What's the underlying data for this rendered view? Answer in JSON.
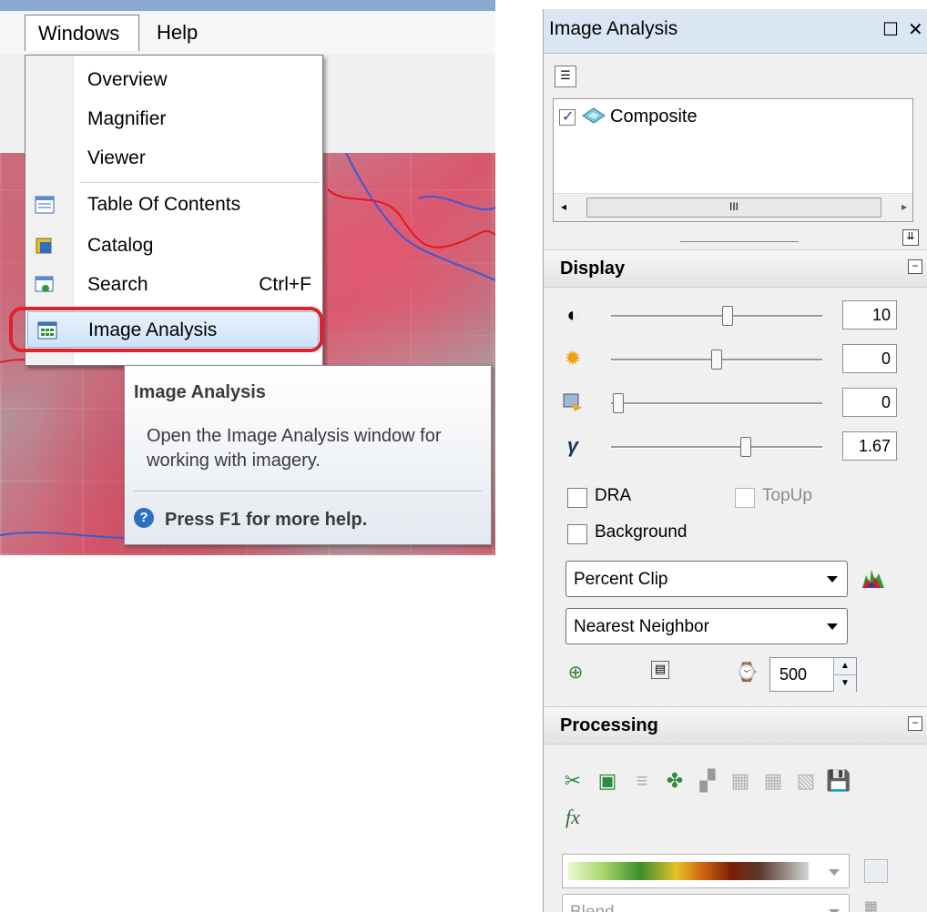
{
  "menubar": {
    "windows": "Windows",
    "help": "Help"
  },
  "windows_menu": {
    "items": [
      {
        "label": "Overview",
        "shortcut": "",
        "icon": ""
      },
      {
        "label": "Magnifier",
        "shortcut": "",
        "icon": ""
      },
      {
        "label": "Viewer",
        "shortcut": "",
        "icon": ""
      },
      {
        "label": "Table Of Contents",
        "shortcut": "",
        "icon": "table-of-contents-icon"
      },
      {
        "label": "Catalog",
        "shortcut": "",
        "icon": "catalog-icon"
      },
      {
        "label": "Search",
        "shortcut": "Ctrl+F",
        "icon": "search-window-icon"
      },
      {
        "label": "Image Analysis",
        "shortcut": "",
        "icon": "image-analysis-icon"
      }
    ]
  },
  "tooltip": {
    "title": "Image Analysis",
    "description": "Open the Image Analysis window for working with imagery.",
    "help": "Press F1 for more help."
  },
  "panel": {
    "title": "Image Analysis",
    "layers": [
      {
        "name": "Composite",
        "checked": true
      }
    ],
    "scroll_thumb": "III",
    "display": {
      "header": "Display",
      "sliders": [
        {
          "name": "contrast",
          "icon": "contrast-icon",
          "value": "10",
          "level": 0.55
        },
        {
          "name": "brightness",
          "icon": "brightness-icon",
          "value": "0",
          "level": 0.5
        },
        {
          "name": "transparency",
          "icon": "transparency-icon",
          "value": "0",
          "level": 0.0
        },
        {
          "name": "gamma",
          "icon": "gamma-icon",
          "value": "1.67",
          "level": 0.6
        }
      ],
      "dra": "DRA",
      "topup": "TopUp",
      "background": "Background",
      "stretch": "Percent Clip",
      "resampling": "Nearest Neighbor",
      "refresh_value": "500"
    },
    "processing": {
      "header": "Processing",
      "blend": "Blend"
    }
  },
  "colors": {
    "highlight_ring": "#e0202e",
    "titlebar": "#dbe6f4"
  }
}
